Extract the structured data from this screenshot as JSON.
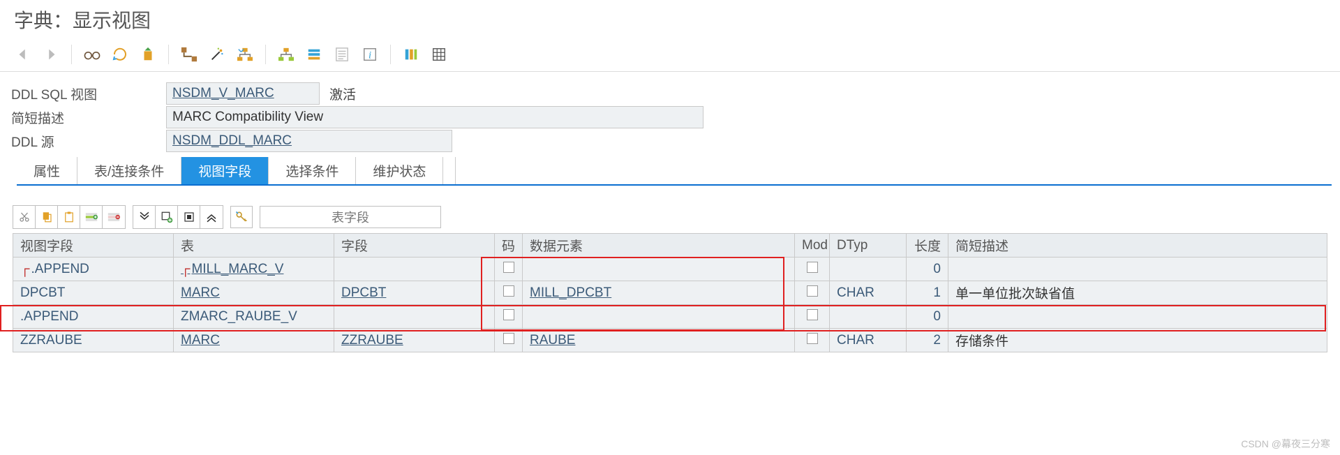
{
  "page_title": "字典：显示视图",
  "header": {
    "ddl_sql_view_label": "DDL SQL 视图",
    "ddl_sql_view_value": "NSDM_V_MARC",
    "status_text": "激活",
    "short_desc_label": "简短描述",
    "short_desc_value": "MARC Compatibility View",
    "ddl_source_label": "DDL 源",
    "ddl_source_value": "NSDM_DDL_MARC"
  },
  "tabs": [
    {
      "id": "attributes",
      "label": "属性",
      "active": false
    },
    {
      "id": "join",
      "label": "表/连接条件",
      "active": false
    },
    {
      "id": "viewfields",
      "label": "视图字段",
      "active": true
    },
    {
      "id": "selection",
      "label": "选择条件",
      "active": false
    },
    {
      "id": "maint",
      "label": "维护状态",
      "active": false
    }
  ],
  "sub_toolbar": {
    "table_fields_btn": "表字段"
  },
  "table": {
    "columns": {
      "view_field": "视图字段",
      "table": "表",
      "field": "字段",
      "key": "码",
      "data_element": "数据元素",
      "mod": "Mod",
      "dtyp": "DTyp",
      "length": "长度",
      "short_desc": "简短描述"
    },
    "rows": [
      {
        "view_field": ".APPEND",
        "table": "MILL_MARC_V",
        "field": "",
        "data_element": "",
        "dtyp": "",
        "length": "0",
        "desc": ""
      },
      {
        "view_field": "DPCBT",
        "table": "MARC",
        "field": "DPCBT",
        "data_element": "MILL_DPCBT",
        "dtyp": "CHAR",
        "length": "1",
        "desc": "单一单位批次缺省值"
      },
      {
        "view_field": ".APPEND",
        "table": "ZMARC_RAUBE_V",
        "field": "",
        "data_element": "",
        "dtyp": "",
        "length": "0",
        "desc": ""
      },
      {
        "view_field": "ZZRAUBE",
        "table": "MARC",
        "field": "ZZRAUBE",
        "data_element": "RAUBE",
        "dtyp": "CHAR",
        "length": "2",
        "desc": "存储条件"
      }
    ]
  },
  "watermark": "CSDN @幕夜三分寒"
}
